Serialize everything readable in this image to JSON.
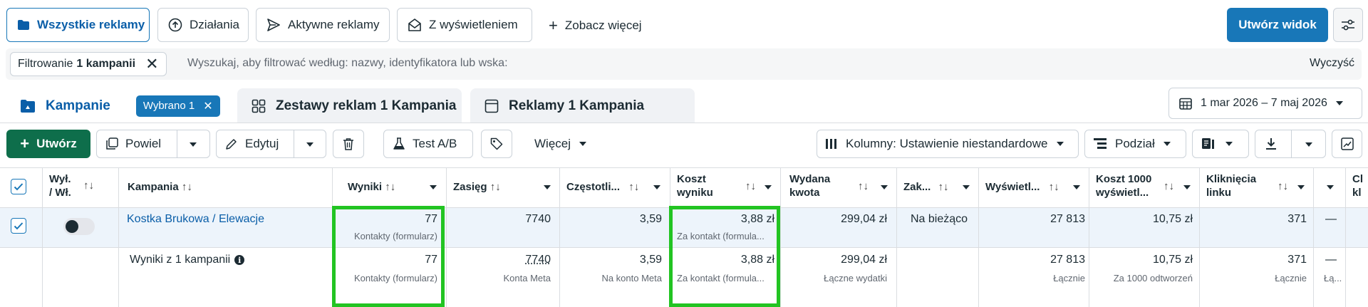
{
  "top_tabs": [
    {
      "label": "Wszystkie reklamy",
      "icon": "folder-icon",
      "active": true
    },
    {
      "label": "Działania",
      "icon": "activity-icon",
      "active": false
    },
    {
      "label": "Aktywne reklamy",
      "icon": "send-icon",
      "active": false
    },
    {
      "label": "Z wyświetleniem",
      "icon": "envelope-open-icon",
      "active": false
    }
  ],
  "see_more": "Zobacz więcej",
  "create_view": "Utwórz widok",
  "filter": {
    "chip_prefix": "Filtrowanie",
    "chip_bold": "1 kampanii",
    "placeholder": "Wyszukaj, aby filtrować według: nazwy, identyfikatora lub wska:",
    "clear": "Wyczyść"
  },
  "level_tabs": {
    "campaigns": "Kampanie",
    "selected_badge": "Wybrano 1",
    "adsets": "Zestawy reklam 1 Kampania",
    "ads": "Reklamy 1 Kampania"
  },
  "date_range": "1 mar 2026 – 7 maj 2026",
  "toolbar": {
    "create": "Utwórz",
    "duplicate": "Powiel",
    "edit": "Edytuj",
    "ab_test": "Test A/B",
    "more": "Więcej",
    "columns": "Kolumny: Ustawienie niestandardowe",
    "breakdown": "Podział"
  },
  "headers": {
    "onoff": [
      "Wył.",
      "/ Wł."
    ],
    "campaign": "Kampania",
    "results": "Wyniki",
    "reach": "Zasięg",
    "frequency": "Częstotli...",
    "cost_per_result": [
      "Koszt",
      "wyniku"
    ],
    "amount_spent": [
      "Wydana",
      "kwota"
    ],
    "end": "Zak...",
    "impressions": "Wyświetl...",
    "cpm": [
      "Koszt 1000",
      "wyświetl..."
    ],
    "link_clicks": [
      "Kliknięcia",
      "linku"
    ],
    "last_partial": [
      "Cl",
      "kl"
    ]
  },
  "row": {
    "name": "Kostka Brukowa / Elewacje",
    "results": "77",
    "results_sub": "Kontakty (formularz)",
    "reach": "7740",
    "frequency": "3,59",
    "cost_per_result": "3,88 zł",
    "cost_sub": "Za kontakt (formula...",
    "amount_spent": "299,04 zł",
    "end": "Na bieżąco",
    "impressions": "27 813",
    "cpm": "10,75 zł",
    "link_clicks": "371",
    "extra": "—"
  },
  "summary": {
    "label": "Wyniki z 1 kampanii",
    "results": "77",
    "results_sub": "Kontakty (formularz)",
    "reach": "7740",
    "reach_sub": "Konta Meta",
    "frequency": "3,59",
    "frequency_sub": "Na konto Meta",
    "cost_per_result": "3,88 zł",
    "cost_sub": "Za kontakt (formula...",
    "amount_spent": "299,04 zł",
    "amount_sub": "Łączne wydatki",
    "impressions": "27 813",
    "impressions_sub": "Łącznie",
    "cpm": "10,75 zł",
    "cpm_sub": "Za 1000 odtworzeń",
    "link_clicks": "371",
    "link_clicks_sub": "Łącznie",
    "extra": "—",
    "extra_sub": "Łą..."
  },
  "colors": {
    "accent": "#1877b8",
    "create_green": "#0e6e4b",
    "highlight": "#22c422",
    "row_selected": "#edf4fb"
  }
}
